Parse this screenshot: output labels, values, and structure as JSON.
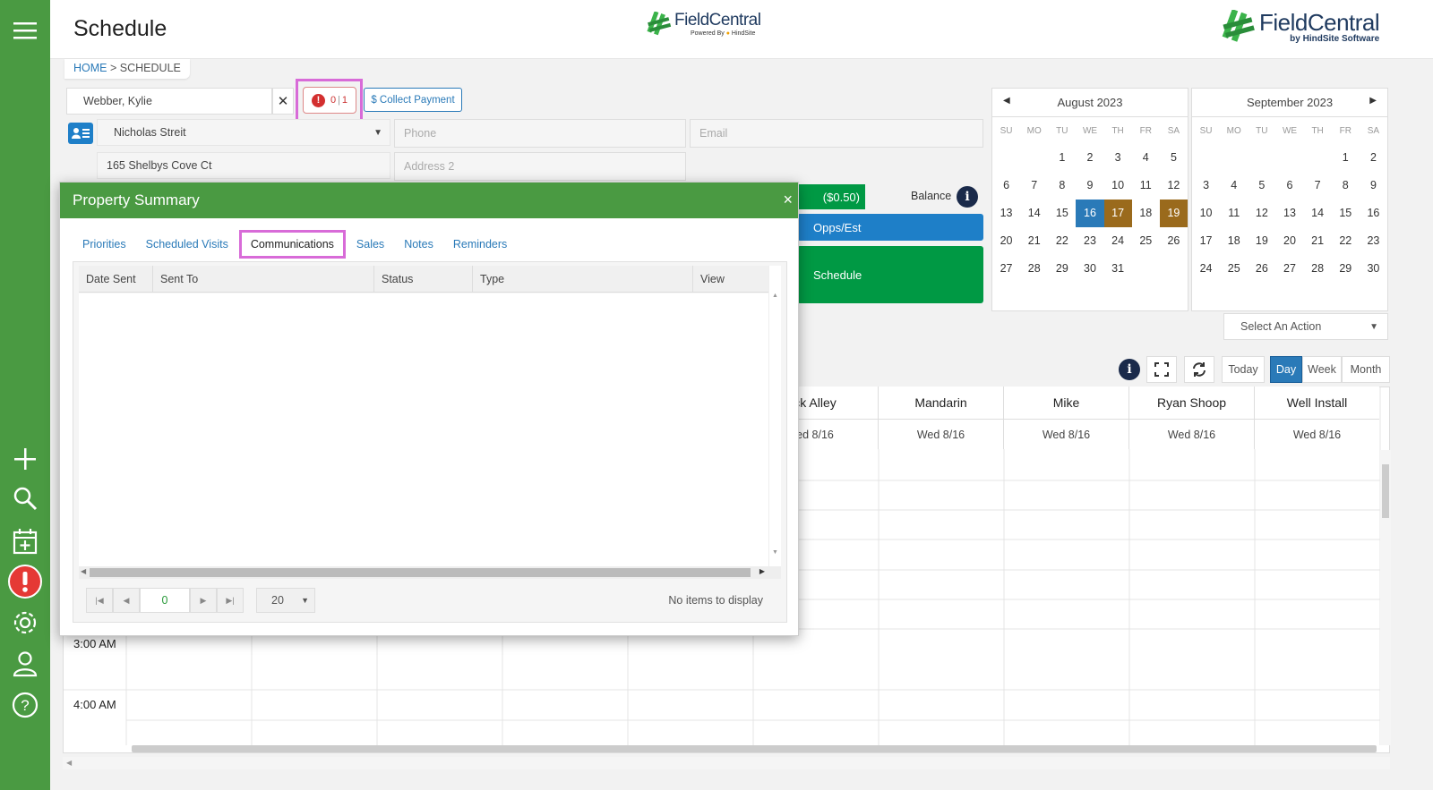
{
  "header": {
    "title": "Schedule",
    "logo_center": "FieldCentral",
    "logo_center_sub": "Powered By",
    "logo_center_sub2": "HindSite",
    "logo_right": "FieldCentral",
    "logo_right_sub": "by HindSite Software"
  },
  "breadcrumb": {
    "home": "HOME",
    "sep": ">",
    "current": "SCHEDULE"
  },
  "customer": {
    "name": "Webber, Kylie",
    "alert_count": "0",
    "alert_total": "1",
    "collect_payment": "$ Collect Payment",
    "contact": "Nicholas Streit",
    "phone_placeholder": "Phone",
    "email_placeholder": "Email",
    "address1": "165 Shelbys Cove Ct",
    "address2_placeholder": "Address 2"
  },
  "balance": {
    "amount": "($0.50)",
    "label": "Balance"
  },
  "buttons": {
    "opps": "Opps/Est",
    "schedule": "Schedule"
  },
  "calendars": [
    {
      "month": "August 2023",
      "dow": [
        "SU",
        "MO",
        "TU",
        "WE",
        "TH",
        "FR",
        "SA"
      ],
      "days": [
        "",
        "",
        "1",
        "2",
        "3",
        "4",
        "5",
        "6",
        "7",
        "8",
        "9",
        "10",
        "11",
        "12",
        "13",
        "14",
        "15",
        "16",
        "17",
        "18",
        "19",
        "20",
        "21",
        "22",
        "23",
        "24",
        "25",
        "26",
        "27",
        "28",
        "29",
        "30",
        "31",
        "",
        ""
      ]
    },
    {
      "month": "September 2023",
      "dow": [
        "SU",
        "MO",
        "TU",
        "WE",
        "TH",
        "FR",
        "SA"
      ],
      "days": [
        "",
        "",
        "",
        "",
        "",
        "1",
        "2",
        "3",
        "4",
        "5",
        "6",
        "7",
        "8",
        "9",
        "10",
        "11",
        "12",
        "13",
        "14",
        "15",
        "16",
        "17",
        "18",
        "19",
        "20",
        "21",
        "22",
        "23",
        "24",
        "25",
        "26",
        "27",
        "28",
        "29",
        "30"
      ]
    }
  ],
  "calendar_highlights": {
    "today": "16",
    "brown": [
      "17",
      "19"
    ],
    "today_color": "#2a7ab8",
    "brown_color": "#9a6a1c"
  },
  "select_action": "Select An Action",
  "view_buttons": {
    "today": "Today",
    "day": "Day",
    "week": "Week",
    "month": "Month"
  },
  "resources": [
    {
      "name": "ck Alley",
      "date": "ed 8/16"
    },
    {
      "name": "Mandarin",
      "date": "Wed 8/16"
    },
    {
      "name": "Mike",
      "date": "Wed 8/16"
    },
    {
      "name": "Ryan Shoop",
      "date": "Wed 8/16"
    },
    {
      "name": "Well Install",
      "date": "Wed 8/16"
    }
  ],
  "times": [
    "3:00 AM",
    "4:00 AM"
  ],
  "modal": {
    "title": "Property Summary",
    "close": "×",
    "tabs": [
      "Priorities",
      "Scheduled Visits",
      "Communications",
      "Sales",
      "Notes",
      "Reminders"
    ],
    "active_tab": "Communications",
    "columns": [
      "Date Sent",
      "Sent To",
      "Status",
      "Type",
      "View"
    ],
    "page": "0",
    "page_size": "20",
    "empty": "No items to display"
  },
  "colors": {
    "sidebar": "#4a9a42",
    "accent_blue": "#2a7ab8",
    "green_btn": "#009944",
    "highlight": "#d86bd8"
  }
}
